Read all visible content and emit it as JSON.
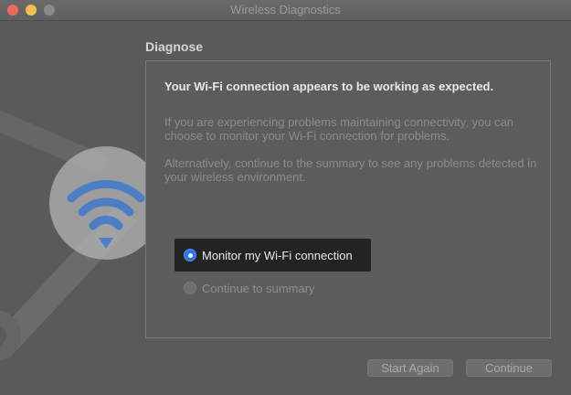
{
  "window": {
    "title": "Wireless Diagnostics",
    "traffic_lights": [
      "close",
      "minimize",
      "zoom"
    ]
  },
  "hero": {
    "icon": "wifi-wrench-icon"
  },
  "section": {
    "title": "Diagnose"
  },
  "panel": {
    "headline": "Your Wi-Fi connection appears to be working as expected.",
    "paragraph1": "If you are experiencing problems maintaining connectivity, you can choose to monitor your Wi-Fi connection for problems.",
    "paragraph2": "Alternatively, continue to the summary to see any problems detected in your wireless environment.",
    "options": [
      {
        "label": "Monitor my Wi-Fi connection",
        "selected": true
      },
      {
        "label": "Continue to summary",
        "selected": false
      }
    ]
  },
  "buttons": {
    "start_again": "Start Again",
    "continue": "Continue"
  },
  "colors": {
    "accent": "#2a72e6",
    "close": "#ee6a5f",
    "minimize": "#f5bf4f"
  }
}
